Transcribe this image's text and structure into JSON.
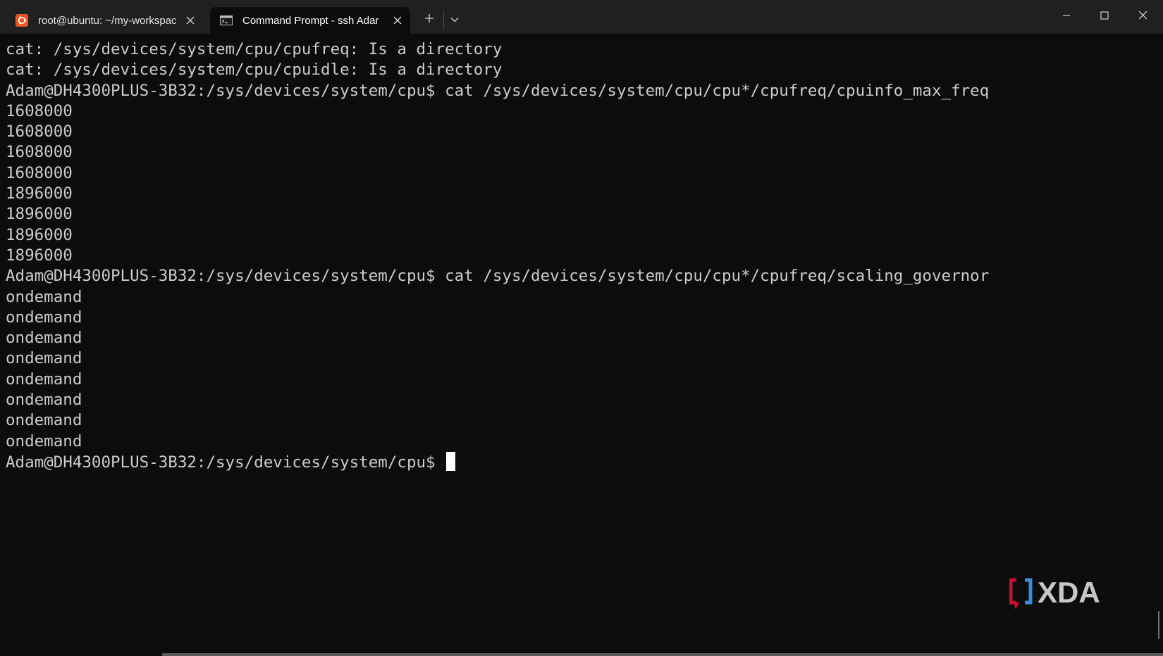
{
  "tabs": [
    {
      "title": "root@ubuntu: ~/my-workspac",
      "icon": "ubuntu-icon",
      "active": false
    },
    {
      "title": "Command Prompt - ssh  Adar",
      "icon": "command-prompt-icon",
      "active": true
    }
  ],
  "titlebar": {
    "new_tab_icon": "plus-icon",
    "dropdown_icon": "chevron-down-icon",
    "minimize_icon": "minimize-icon",
    "maximize_icon": "maximize-icon",
    "close_icon": "close-icon"
  },
  "terminal": {
    "lines": [
      "cat: /sys/devices/system/cpu/cpufreq: Is a directory",
      "cat: /sys/devices/system/cpu/cpuidle: Is a directory",
      "Adam@DH4300PLUS-3B32:/sys/devices/system/cpu$ cat /sys/devices/system/cpu/cpu*/cpufreq/cpuinfo_max_freq",
      "1608000",
      "1608000",
      "1608000",
      "1608000",
      "1896000",
      "1896000",
      "1896000",
      "1896000",
      "Adam@DH4300PLUS-3B32:/sys/devices/system/cpu$ cat /sys/devices/system/cpu/cpu*/cpufreq/scaling_governor",
      "ondemand",
      "ondemand",
      "ondemand",
      "ondemand",
      "ondemand",
      "ondemand",
      "ondemand",
      "ondemand"
    ],
    "prompt": "Adam@DH4300PLUS-3B32:/sys/devices/system/cpu$ "
  },
  "watermark": {
    "text": "XDA",
    "logo_colors": [
      "#c8102e",
      "#3a8dde",
      "#c7c7c7"
    ]
  },
  "colors": {
    "terminal_bg": "#0c0c0c",
    "terminal_fg": "#cccccc",
    "titlebar_bg": "#202020",
    "ubuntu_orange": "#e95420"
  }
}
